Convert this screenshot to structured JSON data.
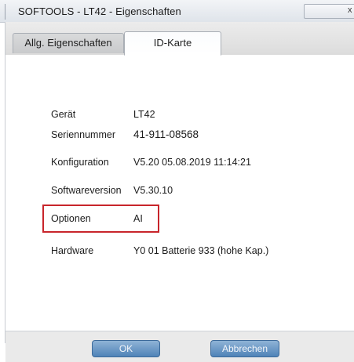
{
  "window": {
    "title": "SOFTOOLS - LT42 - Eigenschaften",
    "close_symbol": "x"
  },
  "tabs": [
    {
      "label": "Allg. Eigenschaften",
      "selected": false
    },
    {
      "label": "ID-Karte",
      "selected": true
    }
  ],
  "id_card": {
    "rows": [
      {
        "label": "Gerät",
        "value": "LT42"
      },
      {
        "label": "Seriennummer",
        "value": "41-911-08568"
      },
      {
        "label": "Konfiguration",
        "value": "V5.20   05.08.2019 11:14:21"
      },
      {
        "label": "Softwareversion",
        "value": "V5.30.10"
      },
      {
        "label": "Optionen",
        "value": "AI"
      },
      {
        "label": "Hardware",
        "value": "Y0 01 Batterie 933 (hohe Kap.)"
      }
    ],
    "highlighted_row": "Optionen"
  },
  "buttons": {
    "ok_label": "OK",
    "cancel_label": "Abbrechen"
  },
  "colors": {
    "highlight_border": "#c8252b",
    "button_blue": "#4f83b8"
  },
  "icons": {
    "close": "close-icon"
  }
}
